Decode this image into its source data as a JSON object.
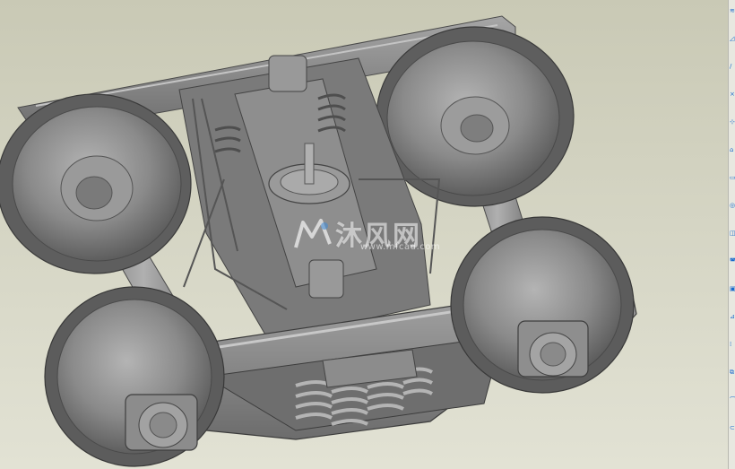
{
  "viewport": {
    "background_top": "#c9c9b5",
    "background_bottom": "#e2e2d4",
    "model_color": "#8a8a8a"
  },
  "watermark": {
    "title": "沐风网",
    "url": "www.mfcad.com",
    "logo_icon": "mf-logo-icon"
  },
  "toolbar": {
    "buttons": [
      {
        "icon": "axis-icon",
        "glyph": "≋"
      },
      {
        "icon": "datum-plane-icon",
        "glyph": "◿"
      },
      {
        "icon": "sketch-icon",
        "glyph": "/"
      },
      {
        "icon": "point-icon",
        "glyph": "×"
      },
      {
        "icon": "csys-icon",
        "glyph": "⊹"
      },
      {
        "icon": "analysis-icon",
        "glyph": "⌂"
      },
      {
        "icon": "extrude-icon",
        "glyph": "▭"
      },
      {
        "icon": "revolve-icon",
        "glyph": "◎"
      },
      {
        "icon": "hole-icon",
        "glyph": "◫"
      },
      {
        "icon": "round-icon",
        "glyph": "◚"
      },
      {
        "icon": "shell-icon",
        "glyph": "▣"
      },
      {
        "icon": "rib-icon",
        "glyph": "⊿"
      },
      {
        "icon": "pattern-icon",
        "glyph": "⁞"
      },
      {
        "icon": "mirror-icon",
        "glyph": "⧉"
      },
      {
        "icon": "trim-icon",
        "glyph": "⌒"
      },
      {
        "icon": "merge-icon",
        "glyph": "⊂"
      }
    ]
  }
}
